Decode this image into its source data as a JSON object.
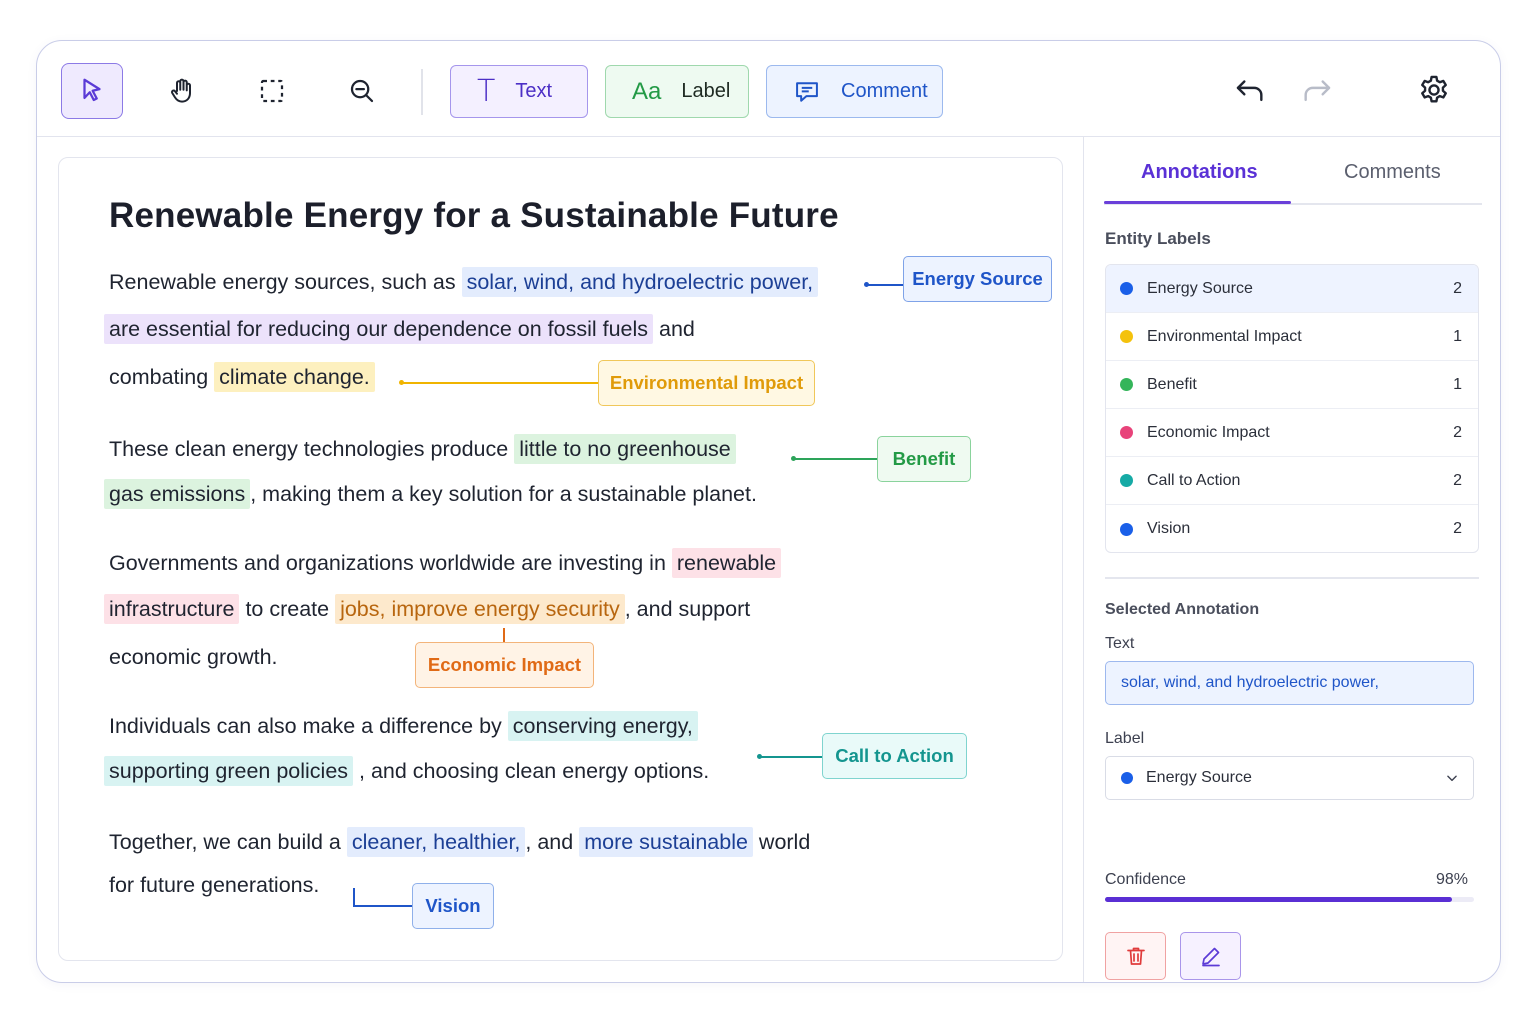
{
  "toolbar": {
    "tools": [
      {
        "name": "select",
        "icon": "cursor-icon",
        "active": true
      },
      {
        "name": "pan",
        "icon": "hand-icon"
      },
      {
        "name": "marquee",
        "icon": "marquee-select-icon"
      },
      {
        "name": "zoom-out",
        "icon": "zoom-out-icon"
      }
    ],
    "text_label": "Text",
    "text_glyph": "T",
    "label_label": "Label",
    "label_glyph": "Aa",
    "comment_label": "Comment",
    "icons": {
      "undo": "undo-icon",
      "redo": "redo-icon",
      "settings": "gear-icon"
    }
  },
  "document": {
    "title": "Renewable Energy for a Sustainable Future",
    "p1": {
      "a": "Renewable energy sources, such as ",
      "h1": "solar, wind, and hydroelectric power,",
      "h2": "are essential for reducing our dependence on fossil fuels",
      "b": " and",
      "c": "combating ",
      "h3": "climate change."
    },
    "p2": {
      "a": "These clean energy technologies produce ",
      "h1": "little to no greenhouse",
      "h2": "gas emissions",
      "b": ", making them a key solution for a sustainable planet."
    },
    "p3": {
      "a": "Governments and organizations worldwide are investing in ",
      "h1": "renewable",
      "h2": "infrastructure",
      "b": " to create ",
      "h3": "jobs, improve energy security",
      "c": ", and support",
      "d": "economic growth."
    },
    "p4": {
      "a": "Individuals can also make a difference by ",
      "h1": "conserving energy,",
      "h2": "supporting green policies",
      "b": " , and choosing clean energy options."
    },
    "p5": {
      "a": "Together, we can build a ",
      "h1": "cleaner, healthier,",
      "b": ", and ",
      "h2": "more sustainable",
      "c": " world",
      "d": "for future generations."
    },
    "tags": {
      "energy_source": "Energy Source",
      "environmental_impact": "Environmental Impact",
      "benefit": "Benefit",
      "economic_impact": "Economic Impact",
      "call_to_action": "Call to Action",
      "vision": "Vision"
    }
  },
  "panel": {
    "tabs": [
      "Annotations",
      "Comments"
    ],
    "entity_labels_heading": "Entity Labels",
    "entity_labels": [
      {
        "name": "Energy Source",
        "count": "2",
        "color": "#1a5fe8"
      },
      {
        "name": "Environmental Impact",
        "count": "1",
        "color": "#f4c20d"
      },
      {
        "name": "Benefit",
        "count": "1",
        "color": "#34b55a"
      },
      {
        "name": "Economic Impact",
        "count": "2",
        "color": "#e8437a"
      },
      {
        "name": "Call to Action",
        "count": "2",
        "color": "#16aaa5"
      },
      {
        "name": "Vision",
        "count": "2",
        "color": "#1a5fe8"
      }
    ],
    "selected_heading": "Selected Annotation",
    "text_label": "Text",
    "text_value": "solar, wind, and hydroelectric power,",
    "label_label": "Label",
    "label_value": "Energy Source",
    "label_color": "#1a5fe8",
    "confidence_label": "Confidence",
    "confidence_text": "98%",
    "confidence": 0.98,
    "actions": {
      "delete": "trash-icon",
      "edit": "pencil-icon"
    }
  }
}
